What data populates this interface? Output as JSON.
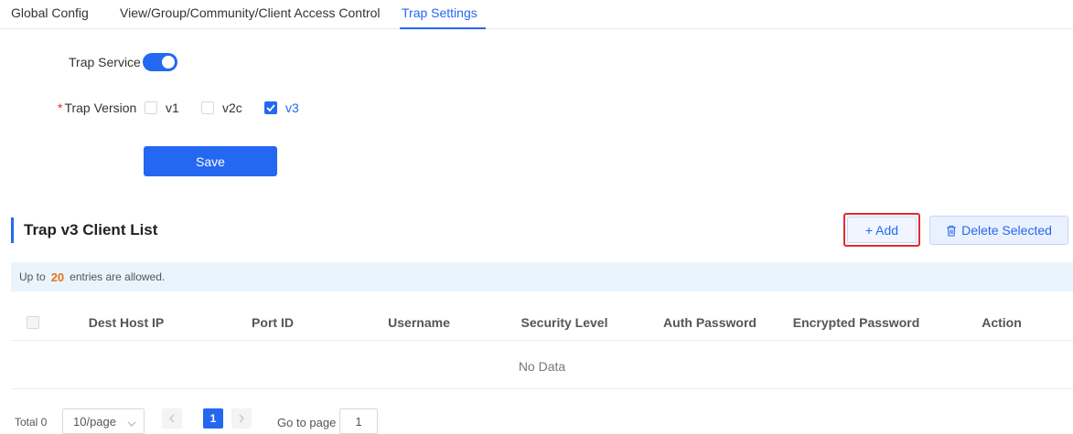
{
  "tabs": [
    {
      "label": "Global Config"
    },
    {
      "label": "View/Group/Community/Client Access Control"
    },
    {
      "label": "Trap Settings"
    }
  ],
  "active_tab": "Trap Settings",
  "form": {
    "trap_service_label": "Trap Service",
    "trap_service_on": true,
    "trap_version_required_mark": "*",
    "trap_version_label": "Trap Version",
    "versions": [
      {
        "label": "v1",
        "checked": false
      },
      {
        "label": "v2c",
        "checked": false
      },
      {
        "label": "v3",
        "checked": true
      }
    ],
    "save_label": "Save"
  },
  "section": {
    "title": "Trap v3 Client List",
    "add_label": "+ Add",
    "delete_label": "Delete Selected"
  },
  "notice": {
    "prefix": "Up to",
    "count": "20",
    "suffix": "entries are allowed."
  },
  "table": {
    "columns": [
      "Dest Host IP",
      "Port ID",
      "Username",
      "Security Level",
      "Auth Password",
      "Encrypted Password",
      "Action"
    ],
    "empty_text": "No Data"
  },
  "pagination": {
    "total": "Total 0",
    "page_size": "10/page",
    "current_page": "1",
    "goto_label": "Go to page",
    "goto_value": "1"
  },
  "colors": {
    "accent": "#2468f2",
    "highlight_border": "#e02b2b",
    "notice_number": "#e8731b"
  }
}
